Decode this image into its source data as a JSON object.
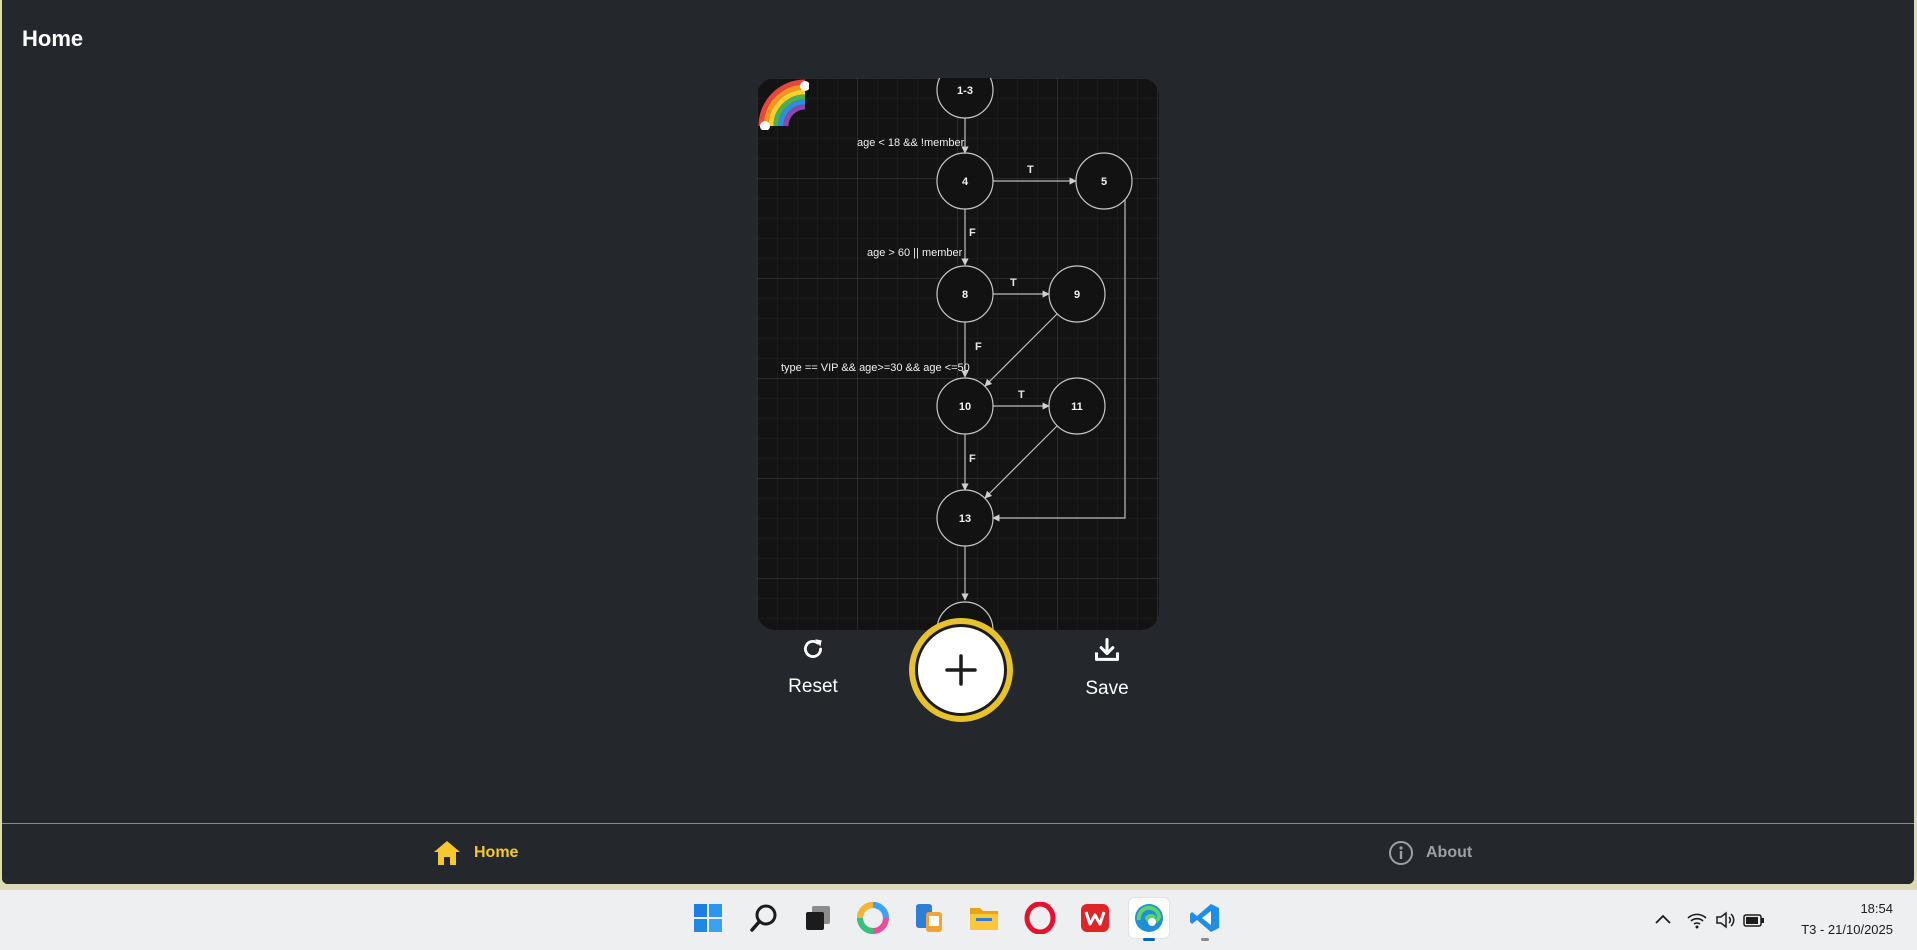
{
  "header": {
    "title": "Home"
  },
  "graph": {
    "nodes": [
      {
        "id": "n13a",
        "label": "1-3"
      },
      {
        "id": "n4",
        "label": "4"
      },
      {
        "id": "n5",
        "label": "5"
      },
      {
        "id": "n8",
        "label": "8"
      },
      {
        "id": "n9",
        "label": "9"
      },
      {
        "id": "n10",
        "label": "10"
      },
      {
        "id": "n11",
        "label": "11"
      },
      {
        "id": "n13",
        "label": "13"
      },
      {
        "id": "nbottom",
        "label": ""
      }
    ],
    "edges": [
      {
        "from": "n13a",
        "to": "n4",
        "label": ""
      },
      {
        "from": "n4",
        "to": "n5",
        "label": "T"
      },
      {
        "from": "n4",
        "to": "n8",
        "label": "F"
      },
      {
        "from": "n8",
        "to": "n9",
        "label": "T"
      },
      {
        "from": "n8",
        "to": "n10",
        "label": "F"
      },
      {
        "from": "n9",
        "to": "n10",
        "label": ""
      },
      {
        "from": "n10",
        "to": "n11",
        "label": "T"
      },
      {
        "from": "n10",
        "to": "n13",
        "label": "F"
      },
      {
        "from": "n11",
        "to": "n13",
        "label": ""
      },
      {
        "from": "n5",
        "to": "n13",
        "label": ""
      },
      {
        "from": "n13",
        "to": "nbottom",
        "label": ""
      }
    ],
    "conditions": {
      "c1": "age < 18 && !member",
      "c2": "age > 60 || member",
      "c3": "type == VIP &&  age>=30 && age <=50"
    },
    "sticker": "rainbow"
  },
  "toolbar": {
    "reset_label": "Reset",
    "save_label": "Save",
    "reset_icon": "refresh-icon",
    "save_icon": "download-icon",
    "add_icon": "plus-icon"
  },
  "nav": {
    "home_label": "Home",
    "about_label": "About",
    "active_color": "#f7c82e"
  },
  "taskbar": {
    "apps": [
      "windows-start",
      "search",
      "task-view",
      "copilot",
      "phone-link",
      "file-explorer",
      "opera",
      "wps-office",
      "edge",
      "vscode"
    ],
    "time": "18:54",
    "date": "T3 - 21/10/2025"
  }
}
